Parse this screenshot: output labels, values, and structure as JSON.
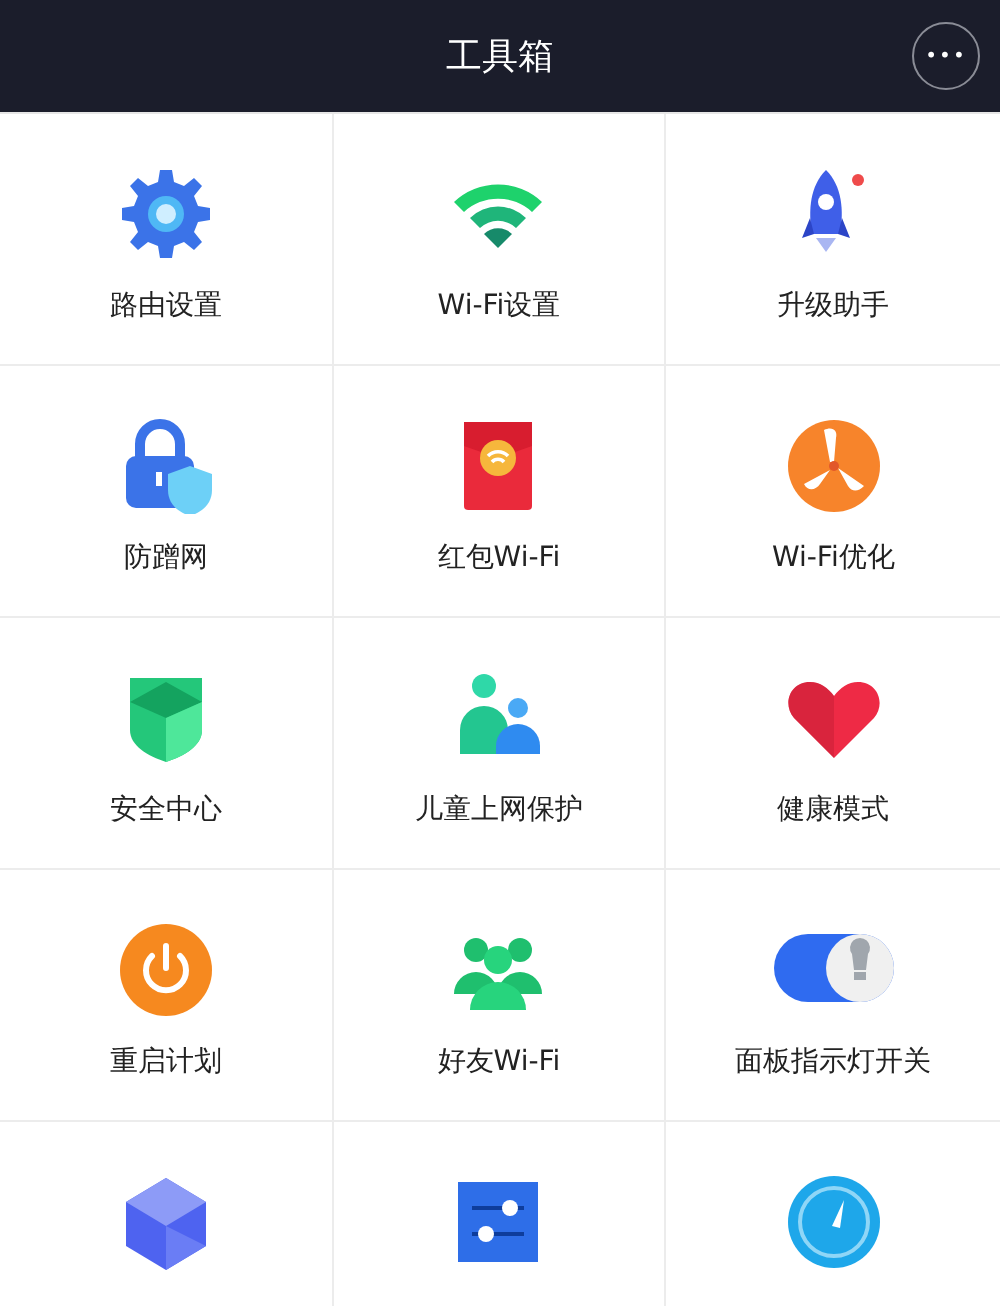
{
  "header": {
    "title": "工具箱",
    "more_button": "•••"
  },
  "tools": [
    {
      "kind": "gear",
      "label": "路由设置"
    },
    {
      "kind": "wifi",
      "label": "Wi-Fi设置"
    },
    {
      "kind": "rocket",
      "label": "升级助手"
    },
    {
      "kind": "lock",
      "label": "防蹭网"
    },
    {
      "kind": "envelope",
      "label": "红包Wi-Fi"
    },
    {
      "kind": "fan",
      "label": "Wi-Fi优化"
    },
    {
      "kind": "shield",
      "label": "安全中心"
    },
    {
      "kind": "people",
      "label": "儿童上网保护"
    },
    {
      "kind": "heart",
      "label": "健康模式"
    },
    {
      "kind": "power",
      "label": "重启计划"
    },
    {
      "kind": "group",
      "label": "好友Wi-Fi"
    },
    {
      "kind": "toggle",
      "label": "面板指示灯开关"
    },
    {
      "kind": "cube"
    },
    {
      "kind": "sliders"
    },
    {
      "kind": "gauge"
    }
  ]
}
